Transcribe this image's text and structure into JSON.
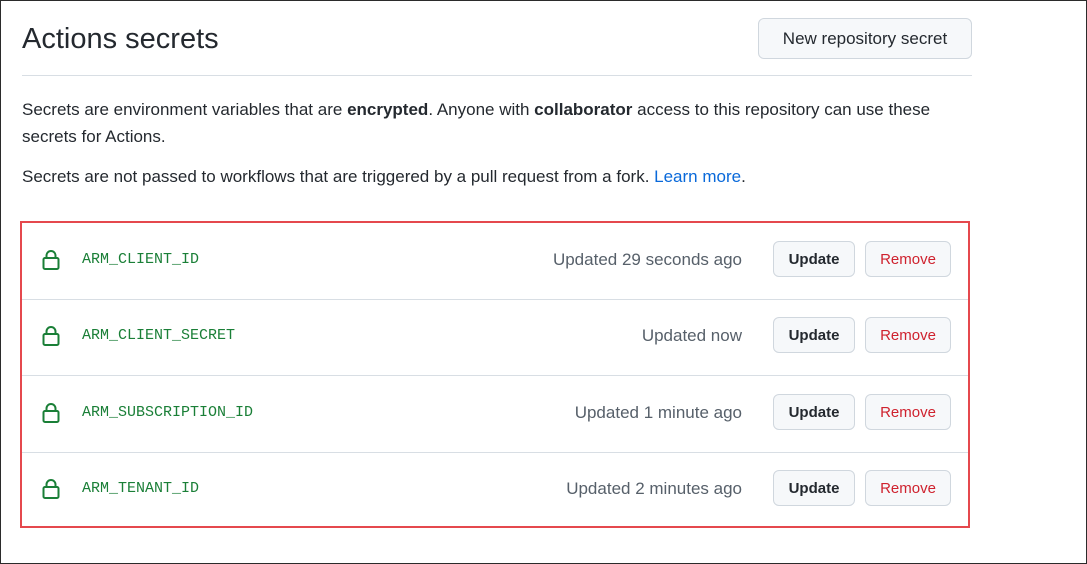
{
  "header": {
    "title": "Actions secrets",
    "new_secret_label": "New repository secret"
  },
  "description": {
    "line1_part1": "Secrets are environment variables that are ",
    "line1_bold1": "encrypted",
    "line1_part2": ". Anyone with ",
    "line1_bold2": "collaborator",
    "line1_part3": " access to this repository can use these secrets for Actions.",
    "line2_text": "Secrets are not passed to workflows that are triggered by a pull request from a fork. ",
    "line2_link": "Learn more",
    "line2_end": "."
  },
  "colors": {
    "secret_name": "#1a7f37",
    "highlight_border": "#e5484d",
    "link": "#0969da",
    "remove": "#cf222e"
  },
  "secrets": [
    {
      "icon": "lock-icon",
      "name": "ARM_CLIENT_ID",
      "updated": "Updated 29 seconds ago",
      "update_label": "Update",
      "remove_label": "Remove"
    },
    {
      "icon": "lock-icon",
      "name": "ARM_CLIENT_SECRET",
      "updated": "Updated now",
      "update_label": "Update",
      "remove_label": "Remove"
    },
    {
      "icon": "lock-icon",
      "name": "ARM_SUBSCRIPTION_ID",
      "updated": "Updated 1 minute ago",
      "update_label": "Update",
      "remove_label": "Remove"
    },
    {
      "icon": "lock-icon",
      "name": "ARM_TENANT_ID",
      "updated": "Updated 2 minutes ago",
      "update_label": "Update",
      "remove_label": "Remove"
    }
  ]
}
